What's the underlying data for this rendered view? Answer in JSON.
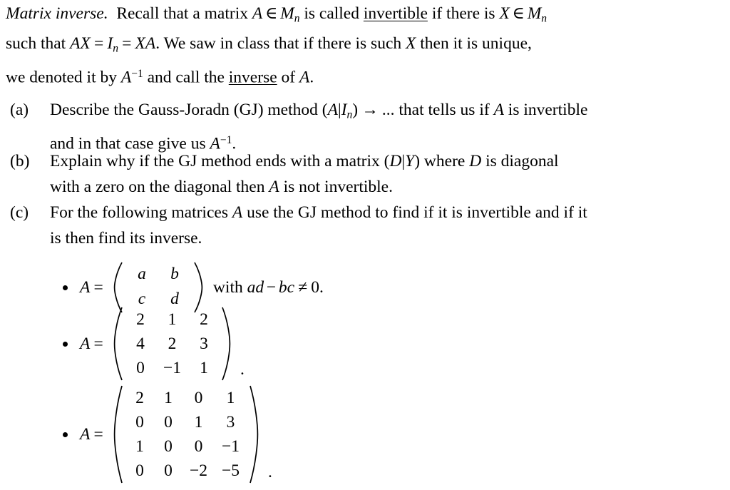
{
  "document": {
    "title_run": "Matrix inverse.",
    "intro": {
      "line1_a": "Recall that a matrix ",
      "line1_A": "A",
      "line1_in": "∈",
      "line1_M": "M",
      "line1_Msub": "n",
      "line1_b": " is called ",
      "line1_underlined": "invertible",
      "line1_c": " if there is ",
      "line1_X": "X",
      "line1_in2": "∈",
      "line1_M2": "M",
      "line1_M2sub": "n",
      "line2_a": "such that ",
      "line2_AX": "AX",
      "line2_eq1": "=",
      "line2_I": "I",
      "line2_Isub": "n",
      "line2_eq2": "=",
      "line2_XA": "XA",
      "line2_b": ". We saw in class that if there is such ",
      "line2_X": "X",
      "line2_c": " then it is unique,",
      "line3_a": "we denoted it by ",
      "line3_A": "A",
      "line3_Asup": "−1",
      "line3_b": " and call the ",
      "line3_underlined": "inverse",
      "line3_c": " of ",
      "line3_A2": "A",
      "line3_d": "."
    },
    "items": [
      {
        "label": "(a)",
        "l1_a": "Describe the Gauss-Joradn (GJ) method (",
        "l1_A": "A",
        "l1_bar": "|",
        "l1_I": "I",
        "l1_Isub": "n",
        "l1_close": ")",
        "l1_arrow": "→",
        "l1_dots": "...",
        "l1_b": " that tells us if ",
        "l1_A2": "A",
        "l1_c": " is invertible",
        "l2_a": "and in that case give us ",
        "l2_A": "A",
        "l2_Asup": "−1",
        "l2_b": "."
      },
      {
        "label": "(b)",
        "l1_a": "Explain why if the GJ method ends with a matrix (",
        "l1_D": "D",
        "l1_bar": "|",
        "l1_Y": "Y",
        "l1_close": ")",
        "l1_b": " where ",
        "l1_D2": "D",
        "l1_c": " is diagonal",
        "l2_a": "with a zero on the diagonal then ",
        "l2_A": "A",
        "l2_b": " is not invertible."
      },
      {
        "label": "(c)",
        "l1_a": "For the following matrices ",
        "l1_A": "A",
        "l1_b": " use the GJ method to find if it is invertible and if it",
        "l2_a": "is then find its inverse."
      }
    ],
    "bullets": [
      {
        "var": "A",
        "equals": "=",
        "matrix_rows": [
          [
            "a",
            "b"
          ],
          [
            "c",
            "d"
          ]
        ],
        "suffix_with": "with ",
        "suffix_ad": "ad",
        "suffix_minus": "−",
        "suffix_bc": "bc",
        "suffix_neq": "≠",
        "suffix_zero": "0",
        "suffix_period": ".",
        "trailing": ""
      },
      {
        "var": "A",
        "equals": "=",
        "matrix_rows": [
          [
            "2",
            "1",
            "2"
          ],
          [
            "4",
            "2",
            "3"
          ],
          [
            "0",
            "−1",
            "1"
          ]
        ],
        "trailing": "."
      },
      {
        "var": "A",
        "equals": "=",
        "matrix_rows": [
          [
            "2",
            "1",
            "0",
            "1"
          ],
          [
            "0",
            "0",
            "1",
            "3"
          ],
          [
            "1",
            "0",
            "0",
            "−1"
          ],
          [
            "0",
            "0",
            "−2",
            "−5"
          ]
        ],
        "trailing": "."
      }
    ]
  },
  "colors": {
    "background": "#ffffff",
    "text": "#000000"
  }
}
